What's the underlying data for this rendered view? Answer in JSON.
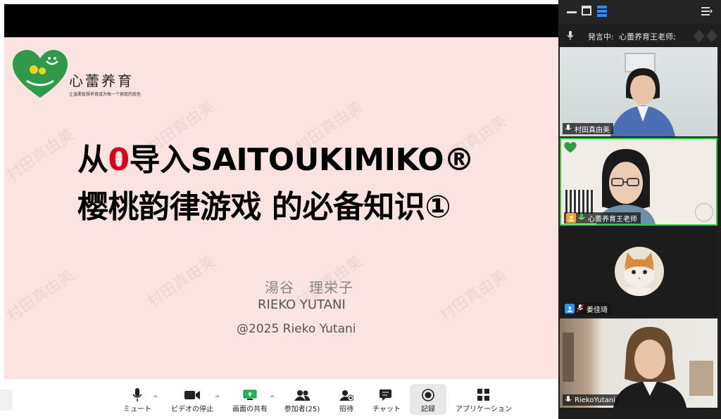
{
  "slide": {
    "logo_name": "心蕾养育",
    "logo_tagline": "让温柔智慧养育成为每一个家庭的底色",
    "title_line1_pre": "从",
    "title_line1_zero": "0",
    "title_line1_post": "导入SAITOUKIMIKO®",
    "title_line2": "樱桃韵律游戏 的必备知识①",
    "author_cjk": "湯谷　理栄子",
    "author_en": "RIEKO YUTANI",
    "copyright": "@2025 Rieko Yutani",
    "watermark": "村田真由美"
  },
  "toolbar": {
    "mute": "ミュート",
    "stop_video": "ビデオの停止",
    "share_screen": "画面の共有",
    "participants": "参加者(25)",
    "invite": "招待",
    "chat": "チャット",
    "record": "記録",
    "apps": "アプリケーション"
  },
  "panel": {
    "speaking_label": "発言中:",
    "speaking_name": "心蕾养育王老师;",
    "participants": [
      {
        "name": "村田真由美"
      },
      {
        "name": "心蕾养育王老师"
      },
      {
        "name": "姜佳琦"
      },
      {
        "name": "RiekoYutani"
      }
    ]
  },
  "colors": {
    "slide_bg": "#fbe3e1",
    "accent_red": "#d9001b",
    "active_border": "#2ecc40",
    "zoom_blue": "#2d8cff",
    "logo_green": "#2e9a4a"
  }
}
